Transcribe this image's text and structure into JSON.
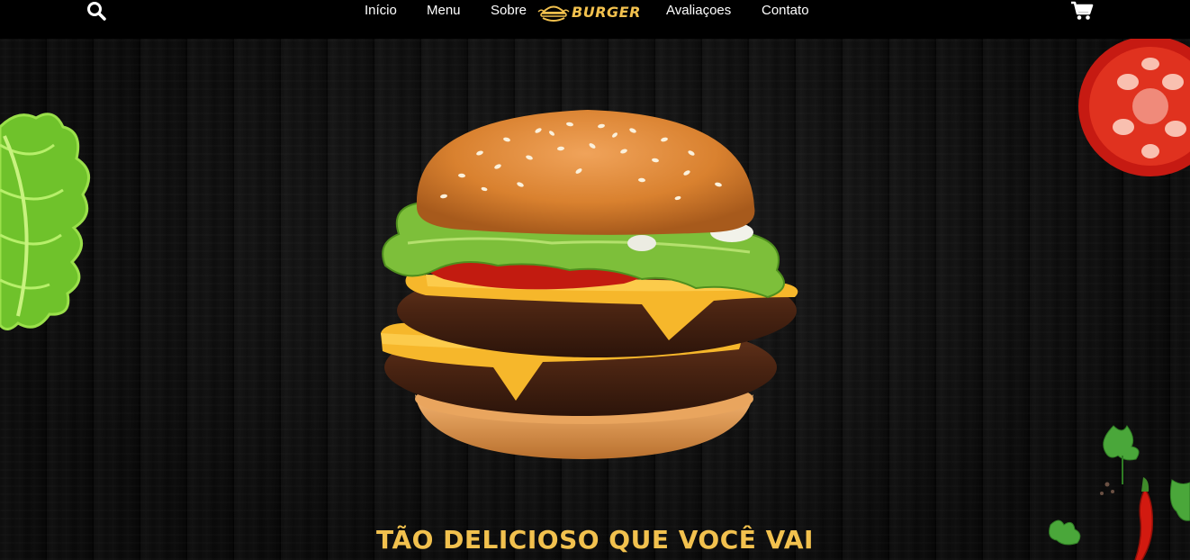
{
  "header": {
    "nav": [
      {
        "label": "Início"
      },
      {
        "label": "Menu"
      },
      {
        "label": "Sobre"
      },
      {
        "label": "Avaliaçoes"
      },
      {
        "label": "Contato"
      }
    ],
    "logo_text": "BURGER",
    "icons": {
      "search": "search-icon",
      "cart": "cart-icon",
      "logo": "burger-logo-icon"
    }
  },
  "hero": {
    "headline": "TÃO DELICIOSO QUE VOCÊ VAI",
    "images": [
      "burger-image",
      "lettuce-image",
      "tomato-image",
      "chili-pepper-image",
      "parsley-image"
    ]
  },
  "colors": {
    "accent": "#f2c14e",
    "header_bg": "#000000",
    "text": "#ffffff"
  }
}
